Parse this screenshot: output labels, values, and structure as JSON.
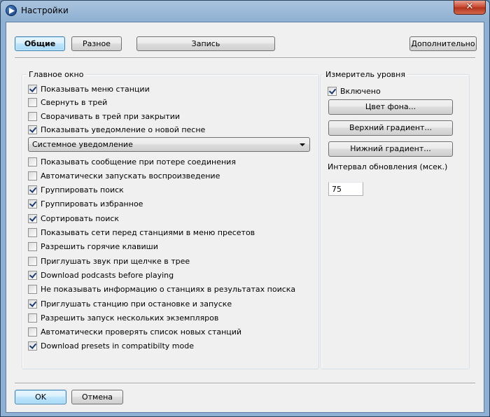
{
  "window": {
    "title": "Настройки",
    "close_label": "✕"
  },
  "tabs": {
    "general": "Общие",
    "misc": "Разное",
    "record": "Запись",
    "advanced": "Дополнительно"
  },
  "main_window": {
    "group_label": "Главное окно",
    "items_top": [
      {
        "label": "Показывать меню станции",
        "checked": true
      },
      {
        "label": "Свернуть в трей",
        "checked": false
      },
      {
        "label": "Сворачивать в трей при закрытии",
        "checked": false
      },
      {
        "label": "Показывать уведомление о новой песне",
        "checked": true
      }
    ],
    "notification_select": "Системное уведомление",
    "items_bottom": [
      {
        "label": "Показывать сообщение при потере соединения",
        "checked": false
      },
      {
        "label": "Автоматически запускать воспроизведение",
        "checked": false
      },
      {
        "label": "Группировать поиск",
        "checked": true
      },
      {
        "label": "Группировать избранное",
        "checked": true
      },
      {
        "label": "Сортировать поиск",
        "checked": true
      },
      {
        "label": "Показывать сети перед станциями в меню пресетов",
        "checked": false
      },
      {
        "label": "Разрешить горячие клавиши",
        "checked": false
      },
      {
        "label": "Приглушать звук при щелчке в трее",
        "checked": false
      },
      {
        "label": "Download podcasts before playing",
        "checked": true
      },
      {
        "label": "Не показывать информацию о станциях в результатах поиска",
        "checked": false
      },
      {
        "label": "Приглушать станцию при остановке и запуске",
        "checked": true
      },
      {
        "label": "Разрешить запуск нескольких экземпляров",
        "checked": false
      },
      {
        "label": "Автоматически проверять список новых станций",
        "checked": false
      },
      {
        "label": "Download presets in compatibilty mode",
        "checked": true
      }
    ]
  },
  "level_meter": {
    "group_label": "Измеритель уровня",
    "enabled": {
      "label": "Включено",
      "checked": true
    },
    "bg_color_button": "Цвет фона...",
    "top_gradient_button": "Верхний градиент...",
    "bottom_gradient_button": "Нижний градиент...",
    "interval_label": "Интервал обновления (мсек.)",
    "interval_value": "75"
  },
  "footer": {
    "ok": "OK",
    "cancel": "Отмена"
  }
}
